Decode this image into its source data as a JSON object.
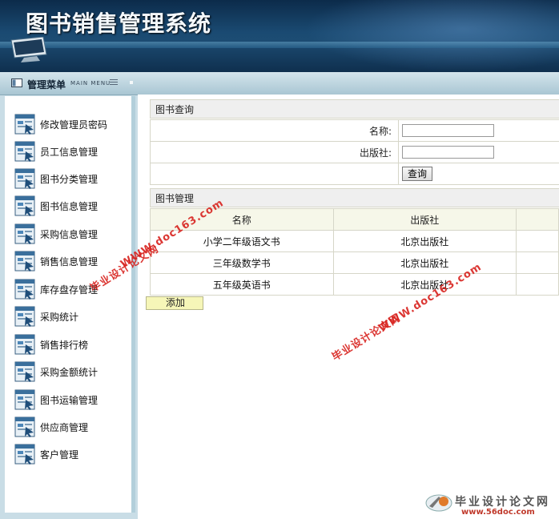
{
  "header": {
    "title": "图书销售管理系统"
  },
  "menubar": {
    "title": "管理菜单",
    "subtitle": "MAIN MENU"
  },
  "sidebar": {
    "items": [
      {
        "label": "修改管理员密码"
      },
      {
        "label": "员工信息管理"
      },
      {
        "label": "图书分类管理"
      },
      {
        "label": "图书信息管理"
      },
      {
        "label": "采购信息管理"
      },
      {
        "label": "销售信息管理"
      },
      {
        "label": "库存盘存管理"
      },
      {
        "label": "采购统计"
      },
      {
        "label": "销售排行榜"
      },
      {
        "label": "采购金额统计"
      },
      {
        "label": "图书运输管理"
      },
      {
        "label": "供应商管理"
      },
      {
        "label": "客户管理"
      }
    ]
  },
  "query": {
    "title": "图书查询",
    "name_label": "名称:",
    "name_value": "",
    "publisher_label": "出版社:",
    "publisher_value": "",
    "search_label": "查询"
  },
  "books": {
    "title": "图书管理",
    "columns": [
      "名称",
      "出版社"
    ],
    "rows": [
      [
        "小学二年级语文书",
        "北京出版社"
      ],
      [
        "三年级数学书",
        "北京出版社"
      ],
      [
        "五年级英语书",
        "北京出版社"
      ]
    ],
    "add_label": "添加"
  },
  "watermarks": {
    "url": "WWW.doc163.com",
    "cn": "毕业设计论文网",
    "logo_cn": "毕业设计论文网",
    "logo_url": "www.56doc.com"
  },
  "colors": {
    "header_bg": "#1a4a72",
    "menubar_bg": "#a9c6d3",
    "accent_watermark": "#d8221e"
  }
}
